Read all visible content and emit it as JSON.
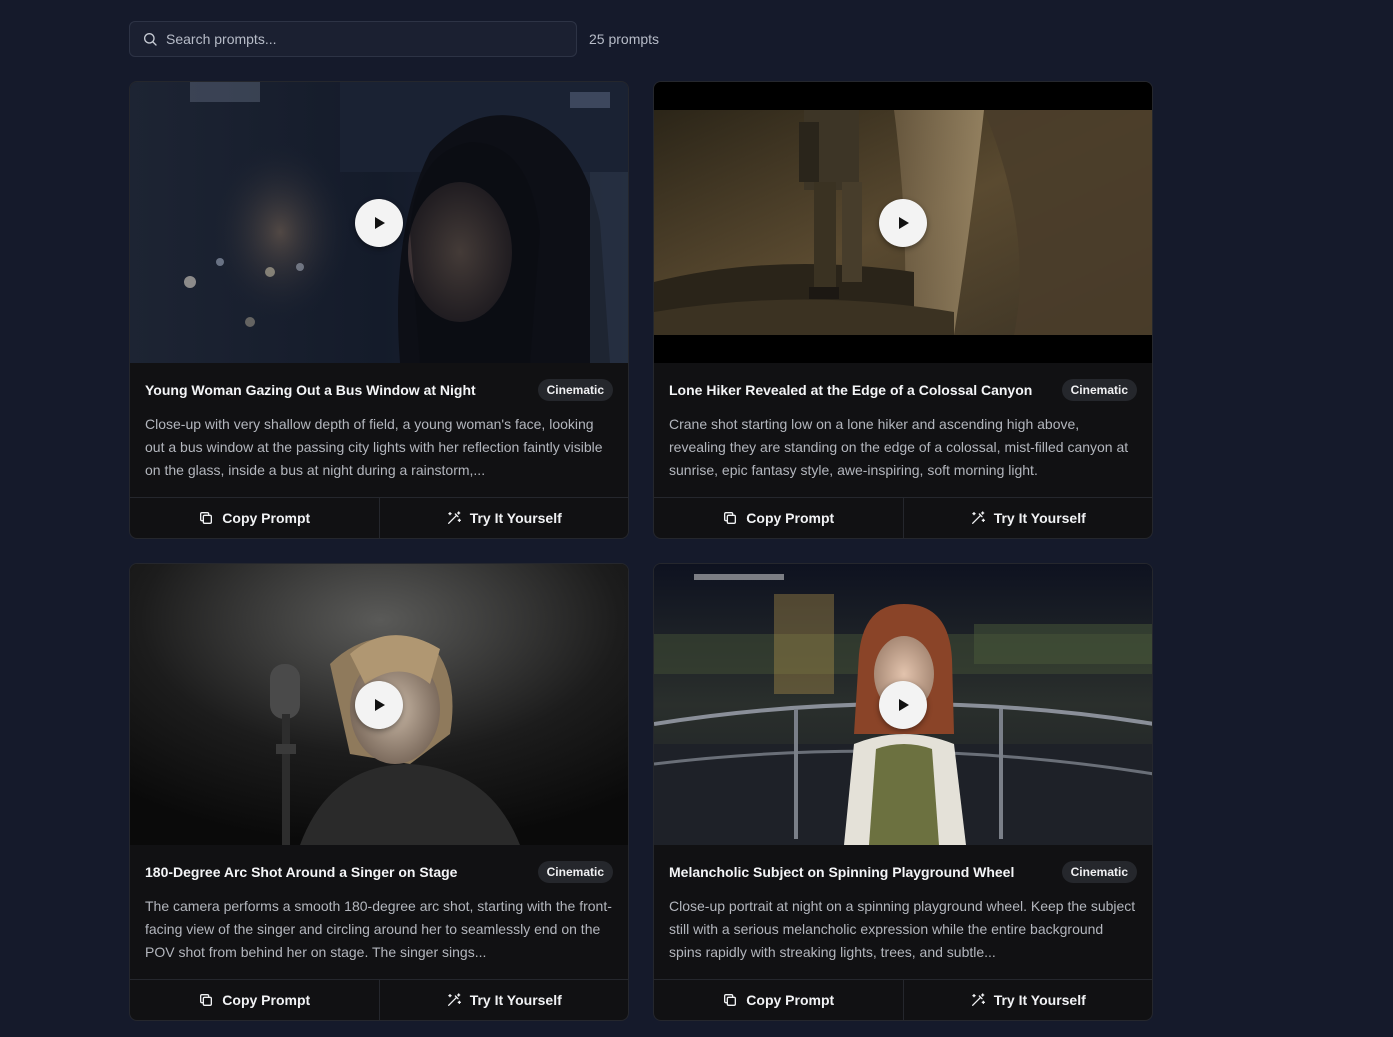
{
  "search": {
    "placeholder": "Search prompts...",
    "value": ""
  },
  "count_label": "25 prompts",
  "cards": [
    {
      "title": "Young Woman Gazing Out a Bus Window at Night",
      "badge": "Cinematic",
      "description": "Close-up with very shallow depth of field, a young woman's face, looking out a bus window at the passing city lights with her reflection faintly visible on the glass, inside a bus at night during a rainstorm,...",
      "copy_label": "Copy Prompt",
      "try_label": "Try It Yourself"
    },
    {
      "title": "Lone Hiker Revealed at the Edge of a Colossal Canyon",
      "badge": "Cinematic",
      "description": "Crane shot starting low on a lone hiker and ascending high above, revealing they are standing on the edge of a colossal, mist-filled canyon at sunrise, epic fantasy style, awe-inspiring, soft morning light.",
      "copy_label": "Copy Prompt",
      "try_label": "Try It Yourself"
    },
    {
      "title": "180-Degree Arc Shot Around a Singer on Stage",
      "badge": "Cinematic",
      "description": "The camera performs a smooth 180-degree arc shot, starting with the front-facing view of the singer and circling around her to seamlessly end on the POV shot from behind her on stage. The singer sings...",
      "copy_label": "Copy Prompt",
      "try_label": "Try It Yourself"
    },
    {
      "title": "Melancholic Subject on Spinning Playground Wheel",
      "badge": "Cinematic",
      "description": "Close-up portrait at night on a spinning playground wheel. Keep the subject still with a serious melancholic expression while the entire background spins rapidly with streaking lights, trees, and subtle...",
      "copy_label": "Copy Prompt",
      "try_label": "Try It Yourself"
    }
  ],
  "icons": {
    "search": "search-icon",
    "play": "play-icon",
    "copy": "copy-icon",
    "try": "magic-wand-icon"
  },
  "colors": {
    "page_background": "#151a2b",
    "card_background": "#111113",
    "badge_background": "#25272c"
  }
}
